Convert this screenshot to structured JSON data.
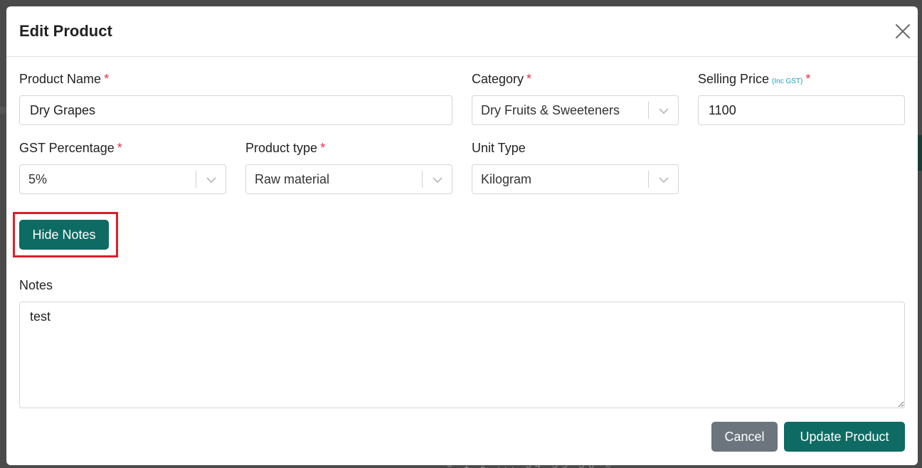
{
  "modal": {
    "title": "Edit Product"
  },
  "form": {
    "product_name": {
      "label": "Product Name",
      "required": "*",
      "value": "Dry Grapes"
    },
    "category": {
      "label": "Category",
      "required": "*",
      "value": "Dry Fruits & Sweeteners"
    },
    "selling_price": {
      "label": "Selling Price",
      "note": "(Inc GST)",
      "required": "*",
      "value": "1100"
    },
    "gst_percentage": {
      "label": "GST Percentage",
      "required": "*",
      "value": "5%"
    },
    "product_type": {
      "label": "Product type",
      "required": "*",
      "value": "Raw material"
    },
    "unit_type": {
      "label": "Unit Type",
      "value": "Kilogram"
    },
    "notes": {
      "label": "Notes",
      "value": "test"
    }
  },
  "buttons": {
    "hide_notes": "Hide Notes",
    "cancel": "Cancel",
    "update": "Update Product"
  },
  "background": {
    "pager_text": "«  1  2 ... 34  35  36  »"
  },
  "colors": {
    "primary": "#0e6b63",
    "secondary": "#6c757d",
    "required": "#dc3545",
    "highlight": "#e11d2a"
  }
}
